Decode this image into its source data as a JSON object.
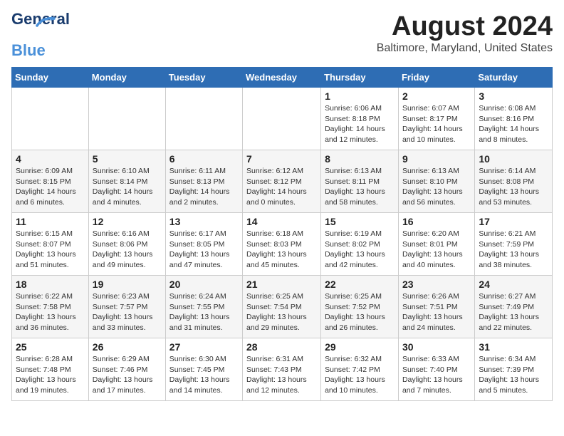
{
  "logo": {
    "line1": "General",
    "line2": "Blue"
  },
  "title": "August 2024",
  "subtitle": "Baltimore, Maryland, United States",
  "days_header": [
    "Sunday",
    "Monday",
    "Tuesday",
    "Wednesday",
    "Thursday",
    "Friday",
    "Saturday"
  ],
  "weeks": [
    [
      {
        "num": "",
        "info": ""
      },
      {
        "num": "",
        "info": ""
      },
      {
        "num": "",
        "info": ""
      },
      {
        "num": "",
        "info": ""
      },
      {
        "num": "1",
        "info": "Sunrise: 6:06 AM\nSunset: 8:18 PM\nDaylight: 14 hours\nand 12 minutes."
      },
      {
        "num": "2",
        "info": "Sunrise: 6:07 AM\nSunset: 8:17 PM\nDaylight: 14 hours\nand 10 minutes."
      },
      {
        "num": "3",
        "info": "Sunrise: 6:08 AM\nSunset: 8:16 PM\nDaylight: 14 hours\nand 8 minutes."
      }
    ],
    [
      {
        "num": "4",
        "info": "Sunrise: 6:09 AM\nSunset: 8:15 PM\nDaylight: 14 hours\nand 6 minutes."
      },
      {
        "num": "5",
        "info": "Sunrise: 6:10 AM\nSunset: 8:14 PM\nDaylight: 14 hours\nand 4 minutes."
      },
      {
        "num": "6",
        "info": "Sunrise: 6:11 AM\nSunset: 8:13 PM\nDaylight: 14 hours\nand 2 minutes."
      },
      {
        "num": "7",
        "info": "Sunrise: 6:12 AM\nSunset: 8:12 PM\nDaylight: 14 hours\nand 0 minutes."
      },
      {
        "num": "8",
        "info": "Sunrise: 6:13 AM\nSunset: 8:11 PM\nDaylight: 13 hours\nand 58 minutes."
      },
      {
        "num": "9",
        "info": "Sunrise: 6:13 AM\nSunset: 8:10 PM\nDaylight: 13 hours\nand 56 minutes."
      },
      {
        "num": "10",
        "info": "Sunrise: 6:14 AM\nSunset: 8:08 PM\nDaylight: 13 hours\nand 53 minutes."
      }
    ],
    [
      {
        "num": "11",
        "info": "Sunrise: 6:15 AM\nSunset: 8:07 PM\nDaylight: 13 hours\nand 51 minutes."
      },
      {
        "num": "12",
        "info": "Sunrise: 6:16 AM\nSunset: 8:06 PM\nDaylight: 13 hours\nand 49 minutes."
      },
      {
        "num": "13",
        "info": "Sunrise: 6:17 AM\nSunset: 8:05 PM\nDaylight: 13 hours\nand 47 minutes."
      },
      {
        "num": "14",
        "info": "Sunrise: 6:18 AM\nSunset: 8:03 PM\nDaylight: 13 hours\nand 45 minutes."
      },
      {
        "num": "15",
        "info": "Sunrise: 6:19 AM\nSunset: 8:02 PM\nDaylight: 13 hours\nand 42 minutes."
      },
      {
        "num": "16",
        "info": "Sunrise: 6:20 AM\nSunset: 8:01 PM\nDaylight: 13 hours\nand 40 minutes."
      },
      {
        "num": "17",
        "info": "Sunrise: 6:21 AM\nSunset: 7:59 PM\nDaylight: 13 hours\nand 38 minutes."
      }
    ],
    [
      {
        "num": "18",
        "info": "Sunrise: 6:22 AM\nSunset: 7:58 PM\nDaylight: 13 hours\nand 36 minutes."
      },
      {
        "num": "19",
        "info": "Sunrise: 6:23 AM\nSunset: 7:57 PM\nDaylight: 13 hours\nand 33 minutes."
      },
      {
        "num": "20",
        "info": "Sunrise: 6:24 AM\nSunset: 7:55 PM\nDaylight: 13 hours\nand 31 minutes."
      },
      {
        "num": "21",
        "info": "Sunrise: 6:25 AM\nSunset: 7:54 PM\nDaylight: 13 hours\nand 29 minutes."
      },
      {
        "num": "22",
        "info": "Sunrise: 6:25 AM\nSunset: 7:52 PM\nDaylight: 13 hours\nand 26 minutes."
      },
      {
        "num": "23",
        "info": "Sunrise: 6:26 AM\nSunset: 7:51 PM\nDaylight: 13 hours\nand 24 minutes."
      },
      {
        "num": "24",
        "info": "Sunrise: 6:27 AM\nSunset: 7:49 PM\nDaylight: 13 hours\nand 22 minutes."
      }
    ],
    [
      {
        "num": "25",
        "info": "Sunrise: 6:28 AM\nSunset: 7:48 PM\nDaylight: 13 hours\nand 19 minutes."
      },
      {
        "num": "26",
        "info": "Sunrise: 6:29 AM\nSunset: 7:46 PM\nDaylight: 13 hours\nand 17 minutes."
      },
      {
        "num": "27",
        "info": "Sunrise: 6:30 AM\nSunset: 7:45 PM\nDaylight: 13 hours\nand 14 minutes."
      },
      {
        "num": "28",
        "info": "Sunrise: 6:31 AM\nSunset: 7:43 PM\nDaylight: 13 hours\nand 12 minutes."
      },
      {
        "num": "29",
        "info": "Sunrise: 6:32 AM\nSunset: 7:42 PM\nDaylight: 13 hours\nand 10 minutes."
      },
      {
        "num": "30",
        "info": "Sunrise: 6:33 AM\nSunset: 7:40 PM\nDaylight: 13 hours\nand 7 minutes."
      },
      {
        "num": "31",
        "info": "Sunrise: 6:34 AM\nSunset: 7:39 PM\nDaylight: 13 hours\nand 5 minutes."
      }
    ]
  ]
}
